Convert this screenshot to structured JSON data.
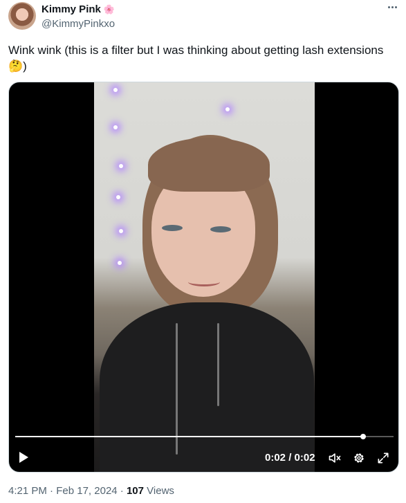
{
  "author": {
    "display_name": "Kimmy Pink",
    "name_emoji": "🌸",
    "handle": "@KimmyPinkxo"
  },
  "tweet": {
    "text": "Wink wink (this is a filter but I was thinking about getting lash extensions 🤔)"
  },
  "video": {
    "time_display": "0:02 / 0:02",
    "progress": 0.92
  },
  "meta": {
    "time": "4:21 PM",
    "separator": " · ",
    "date": "Feb 17, 2024",
    "views_count": "107",
    "views_label": " Views"
  },
  "icons": {
    "more": "more-horizontal-icon",
    "play": "play-icon",
    "mute": "volume-muted-icon",
    "settings": "settings-gear-icon",
    "fullscreen": "fullscreen-expand-icon"
  },
  "colors": {
    "text_primary": "#0f1419",
    "text_secondary": "#536471",
    "video_bg": "#000000"
  }
}
